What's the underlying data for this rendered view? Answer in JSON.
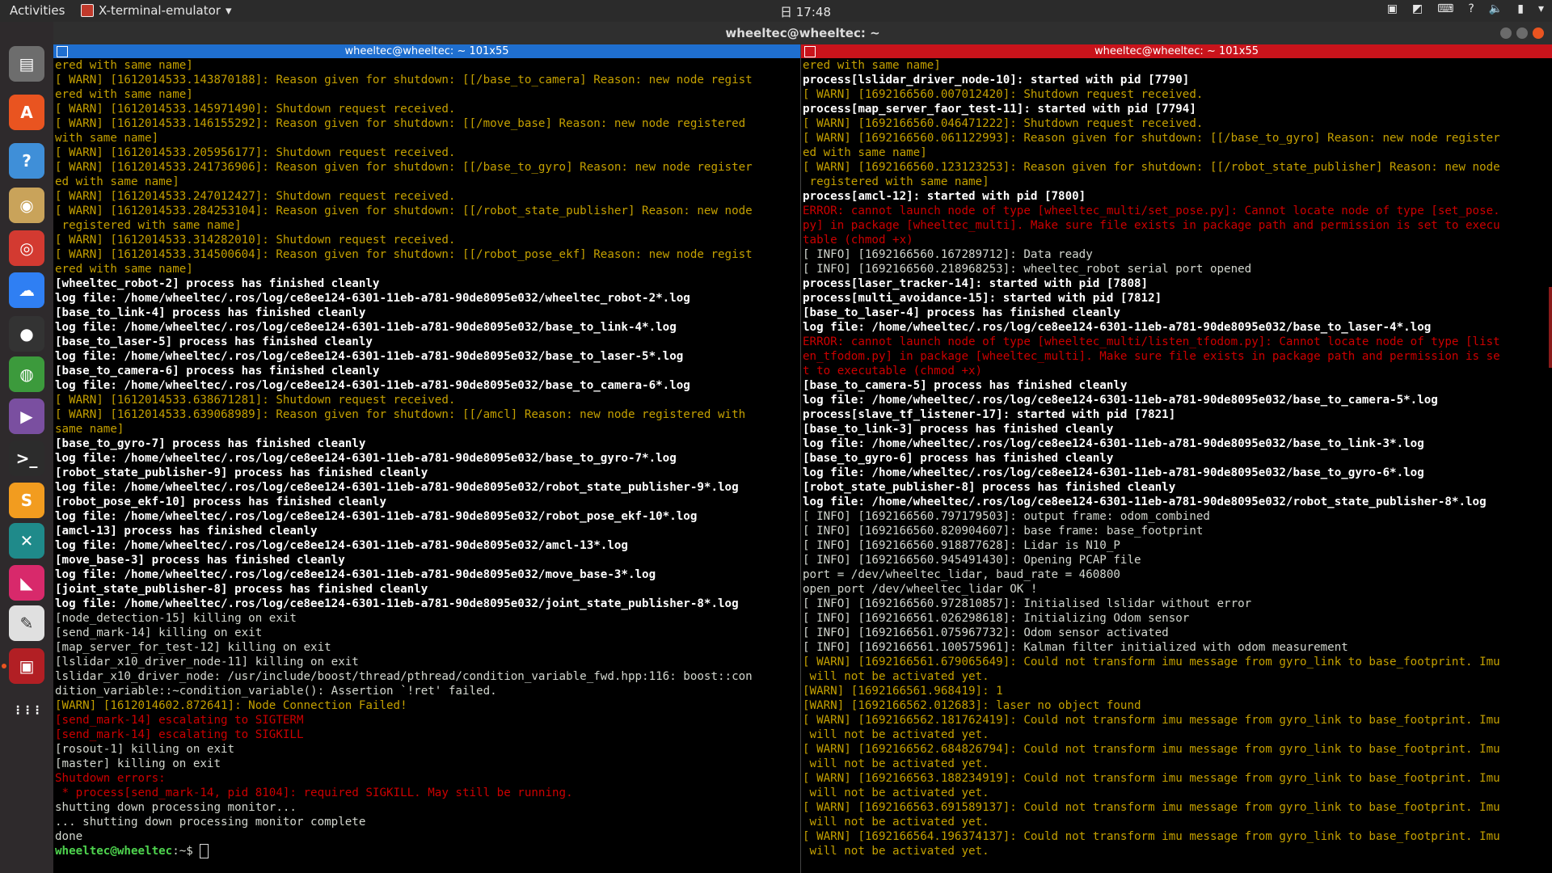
{
  "topbar": {
    "activities": "Activities",
    "app_menu": "X-terminal-emulator",
    "clock": "⽇ 17:48"
  },
  "window": {
    "title": "wheeltec@wheeltec: ~"
  },
  "left": {
    "title": "wheeltec@wheeltec: ~ 101x55",
    "lines": [
      {
        "t": "ered with same name]",
        "c": "w"
      },
      {
        "t": "[ WARN] [1612014533.143870188]: Reason given for shutdown: [[/base_to_camera] Reason: new node regist",
        "c": "w"
      },
      {
        "t": "ered with same name]",
        "c": "w"
      },
      {
        "t": "[ WARN] [1612014533.145971490]: Shutdown request received.",
        "c": "w"
      },
      {
        "t": "[ WARN] [1612014533.146155292]: Reason given for shutdown: [[/move_base] Reason: new node registered",
        "c": "w"
      },
      {
        "t": "with same name]",
        "c": "w"
      },
      {
        "t": "[ WARN] [1612014533.205956177]: Shutdown request received.",
        "c": "w"
      },
      {
        "t": "[ WARN] [1612014533.241736906]: Reason given for shutdown: [[/base_to_gyro] Reason: new node register",
        "c": "w"
      },
      {
        "t": "ed with same name]",
        "c": "w"
      },
      {
        "t": "[ WARN] [1612014533.247012427]: Shutdown request received.",
        "c": "w"
      },
      {
        "t": "[ WARN] [1612014533.284253104]: Reason given for shutdown: [[/robot_state_publisher] Reason: new node",
        "c": "w"
      },
      {
        "t": " registered with same name]",
        "c": "w"
      },
      {
        "t": "[ WARN] [1612014533.314282010]: Shutdown request received.",
        "c": "w"
      },
      {
        "t": "[ WARN] [1612014533.314500604]: Reason given for shutdown: [[/robot_pose_ekf] Reason: new node regist",
        "c": "w"
      },
      {
        "t": "ered with same name]",
        "c": "w"
      },
      {
        "t": "[wheeltec_robot-2] process has finished cleanly",
        "c": "b"
      },
      {
        "t": "log file: /home/wheeltec/.ros/log/ce8ee124-6301-11eb-a781-90de8095e032/wheeltec_robot-2*.log",
        "c": "b"
      },
      {
        "t": "[base_to_link-4] process has finished cleanly",
        "c": "b"
      },
      {
        "t": "log file: /home/wheeltec/.ros/log/ce8ee124-6301-11eb-a781-90de8095e032/base_to_link-4*.log",
        "c": "b"
      },
      {
        "t": "[base_to_laser-5] process has finished cleanly",
        "c": "b"
      },
      {
        "t": "log file: /home/wheeltec/.ros/log/ce8ee124-6301-11eb-a781-90de8095e032/base_to_laser-5*.log",
        "c": "b"
      },
      {
        "t": "[base_to_camera-6] process has finished cleanly",
        "c": "b"
      },
      {
        "t": "log file: /home/wheeltec/.ros/log/ce8ee124-6301-11eb-a781-90de8095e032/base_to_camera-6*.log",
        "c": "b"
      },
      {
        "t": "[ WARN] [1612014533.638671281]: Shutdown request received.",
        "c": "w"
      },
      {
        "t": "[ WARN] [1612014533.639068989]: Reason given for shutdown: [[/amcl] Reason: new node registered with",
        "c": "w"
      },
      {
        "t": "same name]",
        "c": "w"
      },
      {
        "t": "[base_to_gyro-7] process has finished cleanly",
        "c": "b"
      },
      {
        "t": "log file: /home/wheeltec/.ros/log/ce8ee124-6301-11eb-a781-90de8095e032/base_to_gyro-7*.log",
        "c": "b"
      },
      {
        "t": "[robot_state_publisher-9] process has finished cleanly",
        "c": "b"
      },
      {
        "t": "log file: /home/wheeltec/.ros/log/ce8ee124-6301-11eb-a781-90de8095e032/robot_state_publisher-9*.log",
        "c": "b"
      },
      {
        "t": "[robot_pose_ekf-10] process has finished cleanly",
        "c": "b"
      },
      {
        "t": "log file: /home/wheeltec/.ros/log/ce8ee124-6301-11eb-a781-90de8095e032/robot_pose_ekf-10*.log",
        "c": "b"
      },
      {
        "t": "[amcl-13] process has finished cleanly",
        "c": "b"
      },
      {
        "t": "log file: /home/wheeltec/.ros/log/ce8ee124-6301-11eb-a781-90de8095e032/amcl-13*.log",
        "c": "b"
      },
      {
        "t": "[move_base-3] process has finished cleanly",
        "c": "b"
      },
      {
        "t": "log file: /home/wheeltec/.ros/log/ce8ee124-6301-11eb-a781-90de8095e032/move_base-3*.log",
        "c": "b"
      },
      {
        "t": "[joint_state_publisher-8] process has finished cleanly",
        "c": "b"
      },
      {
        "t": "log file: /home/wheeltec/.ros/log/ce8ee124-6301-11eb-a781-90de8095e032/joint_state_publisher-8*.log",
        "c": "b"
      },
      {
        "t": "[node_detection-15] killing on exit",
        "c": ""
      },
      {
        "t": "[send_mark-14] killing on exit",
        "c": ""
      },
      {
        "t": "[map_server_for_test-12] killing on exit",
        "c": ""
      },
      {
        "t": "[lslidar_x10_driver_node-11] killing on exit",
        "c": ""
      },
      {
        "t": "lslidar_x10_driver_node: /usr/include/boost/thread/pthread/condition_variable_fwd.hpp:116: boost::con",
        "c": ""
      },
      {
        "t": "dition_variable::~condition_variable(): Assertion `!ret' failed.",
        "c": ""
      },
      {
        "t": "[WARN] [1612014602.872641]: Node Connection Failed!",
        "c": "w"
      },
      {
        "t": "[send_mark-14] escalating to SIGTERM",
        "c": "e"
      },
      {
        "t": "[send_mark-14] escalating to SIGKILL",
        "c": "e"
      },
      {
        "t": "[rosout-1] killing on exit",
        "c": ""
      },
      {
        "t": "[master] killing on exit",
        "c": ""
      },
      {
        "t": "Shutdown errors:",
        "c": "e"
      },
      {
        "t": " * process[send_mark-14, pid 8104]: required SIGKILL. May still be running.",
        "c": "e"
      },
      {
        "t": "shutting down processing monitor...",
        "c": ""
      },
      {
        "t": "... shutting down processing monitor complete",
        "c": ""
      },
      {
        "t": "done",
        "c": ""
      }
    ],
    "prompt_user": "wheeltec@wheeltec",
    "prompt_path": ":~$ "
  },
  "right": {
    "title": "wheeltec@wheeltec: ~ 101x55",
    "lines": [
      {
        "t": "ered with same name]",
        "c": "w"
      },
      {
        "t": "process[lslidar_driver_node-10]: started with pid [7790]",
        "c": "b"
      },
      {
        "t": "[ WARN] [1692166560.007012420]: Shutdown request received.",
        "c": "w"
      },
      {
        "t": "process[map_server_faor_test-11]: started with pid [7794]",
        "c": "b"
      },
      {
        "t": "[ WARN] [1692166560.046471222]: Shutdown request received.",
        "c": "w"
      },
      {
        "t": "[ WARN] [1692166560.061122993]: Reason given for shutdown: [[/base_to_gyro] Reason: new node register",
        "c": "w"
      },
      {
        "t": "ed with same name]",
        "c": "w"
      },
      {
        "t": "[ WARN] [1692166560.123123253]: Reason given for shutdown: [[/robot_state_publisher] Reason: new node",
        "c": "w"
      },
      {
        "t": " registered with same name]",
        "c": "w"
      },
      {
        "t": "process[amcl-12]: started with pid [7800]",
        "c": "b"
      },
      {
        "t": "ERROR: cannot launch node of type [wheeltec_multi/set_pose.py]: Cannot locate node of type [set_pose.",
        "c": "e"
      },
      {
        "t": "py] in package [wheeltec_multi]. Make sure file exists in package path and permission is set to execu",
        "c": "e"
      },
      {
        "t": "table (chmod +x)",
        "c": "e"
      },
      {
        "t": "[ INFO] [1692166560.167289712]: Data ready",
        "c": ""
      },
      {
        "t": "[ INFO] [1692166560.218968253]: wheeltec_robot serial port opened",
        "c": ""
      },
      {
        "t": "process[laser_tracker-14]: started with pid [7808]",
        "c": "b"
      },
      {
        "t": "process[multi_avoidance-15]: started with pid [7812]",
        "c": "b"
      },
      {
        "t": "[base_to_laser-4] process has finished cleanly",
        "c": "b"
      },
      {
        "t": "log file: /home/wheeltec/.ros/log/ce8ee124-6301-11eb-a781-90de8095e032/base_to_laser-4*.log",
        "c": "b"
      },
      {
        "t": "ERROR: cannot launch node of type [wheeltec_multi/listen_tfodom.py]: Cannot locate node of type [list",
        "c": "e"
      },
      {
        "t": "en_tfodom.py] in package [wheeltec_multi]. Make sure file exists in package path and permission is se",
        "c": "e"
      },
      {
        "t": "t to executable (chmod +x)",
        "c": "e"
      },
      {
        "t": "[base_to_camera-5] process has finished cleanly",
        "c": "b"
      },
      {
        "t": "log file: /home/wheeltec/.ros/log/ce8ee124-6301-11eb-a781-90de8095e032/base_to_camera-5*.log",
        "c": "b"
      },
      {
        "t": "process[slave_tf_listener-17]: started with pid [7821]",
        "c": "b"
      },
      {
        "t": "[base_to_link-3] process has finished cleanly",
        "c": "b"
      },
      {
        "t": "log file: /home/wheeltec/.ros/log/ce8ee124-6301-11eb-a781-90de8095e032/base_to_link-3*.log",
        "c": "b"
      },
      {
        "t": "[base_to_gyro-6] process has finished cleanly",
        "c": "b"
      },
      {
        "t": "log file: /home/wheeltec/.ros/log/ce8ee124-6301-11eb-a781-90de8095e032/base_to_gyro-6*.log",
        "c": "b"
      },
      {
        "t": "[robot_state_publisher-8] process has finished cleanly",
        "c": "b"
      },
      {
        "t": "log file: /home/wheeltec/.ros/log/ce8ee124-6301-11eb-a781-90de8095e032/robot_state_publisher-8*.log",
        "c": "b"
      },
      {
        "t": "[ INFO] [1692166560.797179503]: output frame: odom_combined",
        "c": ""
      },
      {
        "t": "[ INFO] [1692166560.820904607]: base frame: base_footprint",
        "c": ""
      },
      {
        "t": "[ INFO] [1692166560.918877628]: Lidar is N10_P",
        "c": ""
      },
      {
        "t": "[ INFO] [1692166560.945491430]: Opening PCAP file",
        "c": ""
      },
      {
        "t": "port = /dev/wheeltec_lidar, baud_rate = 460800",
        "c": ""
      },
      {
        "t": "open_port /dev/wheeltec_lidar OK !",
        "c": ""
      },
      {
        "t": "[ INFO] [1692166560.972810857]: Initialised lslidar without error",
        "c": ""
      },
      {
        "t": "[ INFO] [1692166561.026298618]: Initializing Odom sensor",
        "c": ""
      },
      {
        "t": "[ INFO] [1692166561.075967732]: Odom sensor activated",
        "c": ""
      },
      {
        "t": "[ INFO] [1692166561.100575961]: Kalman filter initialized with odom measurement",
        "c": ""
      },
      {
        "t": "[ WARN] [1692166561.679065649]: Could not transform imu message from gyro_link to base_footprint. Imu",
        "c": "w"
      },
      {
        "t": " will not be activated yet.",
        "c": "w"
      },
      {
        "t": "[WARN] [1692166561.968419]: 1",
        "c": "w"
      },
      {
        "t": "[WARN] [1692166562.012683]: laser no object found",
        "c": "w"
      },
      {
        "t": "[ WARN] [1692166562.181762419]: Could not transform imu message from gyro_link to base_footprint. Imu",
        "c": "w"
      },
      {
        "t": " will not be activated yet.",
        "c": "w"
      },
      {
        "t": "[ WARN] [1692166562.684826794]: Could not transform imu message from gyro_link to base_footprint. Imu",
        "c": "w"
      },
      {
        "t": " will not be activated yet.",
        "c": "w"
      },
      {
        "t": "[ WARN] [1692166563.188234919]: Could not transform imu message from gyro_link to base_footprint. Imu",
        "c": "w"
      },
      {
        "t": " will not be activated yet.",
        "c": "w"
      },
      {
        "t": "[ WARN] [1692166563.691589137]: Could not transform imu message from gyro_link to base_footprint. Imu",
        "c": "w"
      },
      {
        "t": " will not be activated yet.",
        "c": "w"
      },
      {
        "t": "[ WARN] [1692166564.196374137]: Could not transform imu message from gyro_link to base_footprint. Imu",
        "c": "w"
      },
      {
        "t": " will not be activated yet.",
        "c": "w"
      }
    ]
  },
  "dock": {
    "items": [
      {
        "name": "files-icon",
        "glyph": "▤",
        "color": "#6d6d6d"
      },
      {
        "name": "software-center-icon",
        "glyph": "A",
        "color": "#e95420"
      },
      {
        "name": "help-icon",
        "glyph": "?",
        "color": "#3f8fd8"
      },
      {
        "name": "system-map-icon",
        "glyph": "◉",
        "color": "#c9a35a"
      },
      {
        "name": "netease-music-icon",
        "glyph": "◎",
        "color": "#d33a31"
      },
      {
        "name": "baidu-netdisk-icon",
        "glyph": "☁",
        "color": "#2f7ff3"
      },
      {
        "name": "qq-icon",
        "glyph": "●",
        "color": "#333333"
      },
      {
        "name": "chrome-icon",
        "glyph": "◍",
        "color": "#3c9a3c"
      },
      {
        "name": "video-player-icon",
        "glyph": "▶",
        "color": "#7a4fa0"
      },
      {
        "name": "terminal-icon",
        "glyph": ">_",
        "color": "#2c2c2c"
      },
      {
        "name": "sublime-text-icon",
        "glyph": "S",
        "color": "#f29c1f"
      },
      {
        "name": "vnc-viewer-icon",
        "glyph": "✕",
        "color": "#1f8a8a"
      },
      {
        "name": "kazam-icon",
        "glyph": "◣",
        "color": "#d8296b"
      },
      {
        "name": "text-editor-icon",
        "glyph": "✎",
        "color": "#e0e0e0"
      },
      {
        "name": "x-terminal-emulator-icon",
        "glyph": "▣",
        "color": "#b21f24"
      },
      {
        "name": "show-applications-icon",
        "glyph": "⋮⋮⋮",
        "color": "#2e2a2c"
      }
    ]
  }
}
